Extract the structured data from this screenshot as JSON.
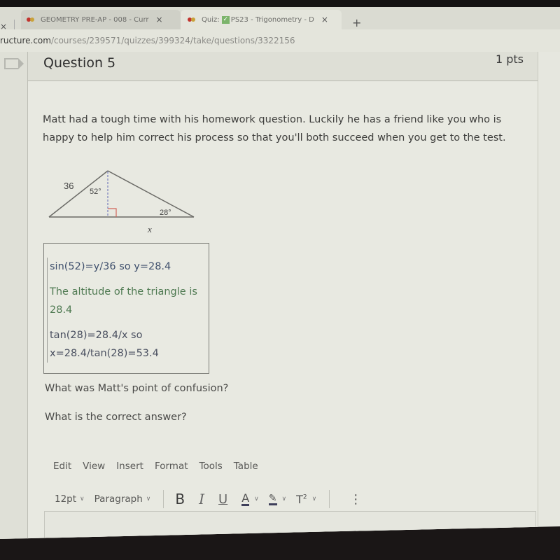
{
  "browser": {
    "tabs": [
      {
        "label": "GEOMETRY PRE-AP - 008 - Curr",
        "active": false
      },
      {
        "label_prefix": "Quiz:",
        "label": "PS23 - Trigonometry - D",
        "active": true
      }
    ],
    "close_glyph": "×",
    "new_tab_glyph": "+",
    "url_host": "ructure.com",
    "url_path": "/courses/239571/quizzes/399324/take/questions/3322156"
  },
  "question": {
    "title": "Question 5",
    "points": "1 pts",
    "prompt": "Matt had a tough time with his homework question.  Luckily he has a friend like you who is happy to help him correct his process so that you'll both succeed when you get to the test.",
    "diagram": {
      "side_label": "36",
      "top_angle": "52°",
      "right_angle_label": "28°",
      "base_label": "x"
    },
    "work": [
      {
        "text": "sin(52)=y/36 so y=28.4",
        "color": "#3e4f6c"
      },
      {
        "text": "The altitude of the triangle is",
        "color": "#4f7a52"
      },
      {
        "text": "28.4",
        "color": "#4f7a52"
      },
      {
        "text": "tan(28)=28.4/x so",
        "color": "#4a5060"
      },
      {
        "text": "x=28.4/tan(28)=53.4",
        "color": "#4a5060"
      }
    ],
    "followups": [
      "What was Matt's point of confusion?",
      "What is the correct answer?"
    ]
  },
  "editor": {
    "menu": [
      "Edit",
      "View",
      "Insert",
      "Format",
      "Tools",
      "Table"
    ],
    "font_size": "12pt",
    "block_format": "Paragraph",
    "bold": "B",
    "italic": "I",
    "underline": "U",
    "text_color": "A",
    "highlight": "✎",
    "superscript": "T",
    "superscript_mark": "2",
    "more": "⋮",
    "chevron": "∨"
  }
}
